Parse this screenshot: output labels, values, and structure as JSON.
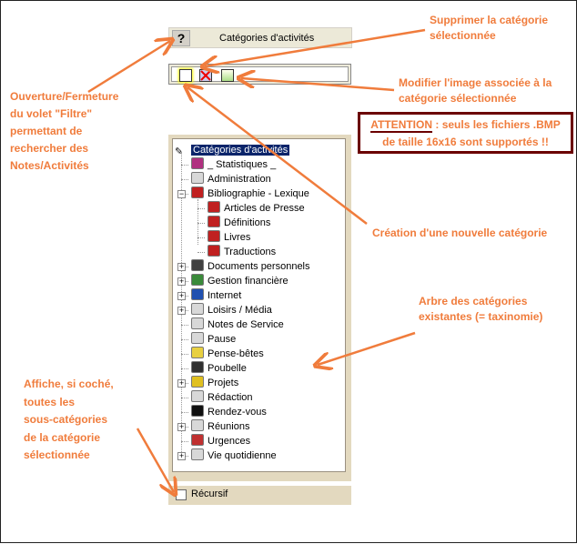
{
  "panel": {
    "help_label": "?",
    "title": "Catégories d'activités",
    "recursive_label": "Récursif",
    "recursive_checked": false
  },
  "toolbar": [
    {
      "icon": "new-category-icon"
    },
    {
      "icon": "delete-category-icon"
    },
    {
      "icon": "change-image-icon"
    }
  ],
  "tree": {
    "root": "Catégories d'activités",
    "items": [
      {
        "label": "_ Statistiques _",
        "level": 1,
        "expander": "",
        "icon": "#b03080"
      },
      {
        "label": "Administration",
        "level": 1,
        "expander": "",
        "icon": "#d8d8d8"
      },
      {
        "label": "Bibliographie - Lexique",
        "level": 1,
        "expander": "-",
        "icon": "#c02020"
      },
      {
        "label": "Articles de Presse",
        "level": 2,
        "expander": "",
        "icon": "#c02020"
      },
      {
        "label": "Définitions",
        "level": 2,
        "expander": "",
        "icon": "#c02020"
      },
      {
        "label": "Livres",
        "level": 2,
        "expander": "",
        "icon": "#c02020"
      },
      {
        "label": "Traductions",
        "level": 2,
        "expander": "",
        "icon": "#c02020"
      },
      {
        "label": "Documents personnels",
        "level": 1,
        "expander": "+",
        "icon": "#404040"
      },
      {
        "label": "Gestion financière",
        "level": 1,
        "expander": "+",
        "icon": "#3a8a3a"
      },
      {
        "label": "Internet",
        "level": 1,
        "expander": "+",
        "icon": "#2050b0"
      },
      {
        "label": "Loisirs / Média",
        "level": 1,
        "expander": "+",
        "icon": "#d8d8d8"
      },
      {
        "label": "Notes de Service",
        "level": 1,
        "expander": "",
        "icon": "#d8d8d8"
      },
      {
        "label": "Pause",
        "level": 1,
        "expander": "",
        "icon": "#d8d8d8"
      },
      {
        "label": "Pense-bêtes",
        "level": 1,
        "expander": "",
        "icon": "#e8d040"
      },
      {
        "label": "Poubelle",
        "level": 1,
        "expander": "",
        "icon": "#303030"
      },
      {
        "label": "Projets",
        "level": 1,
        "expander": "+",
        "icon": "#e0c020"
      },
      {
        "label": "Rédaction",
        "level": 1,
        "expander": "",
        "icon": "#d8d8d8"
      },
      {
        "label": "Rendez-vous",
        "level": 1,
        "expander": "",
        "icon": "#101010"
      },
      {
        "label": "Réunions",
        "level": 1,
        "expander": "+",
        "icon": "#d8d8d8"
      },
      {
        "label": "Urgences",
        "level": 1,
        "expander": "",
        "icon": "#c03030"
      },
      {
        "label": "Vie quotidienne",
        "level": 1,
        "expander": "+",
        "icon": "#d8d8d8"
      }
    ]
  },
  "annotations": {
    "delete": [
      "Supprimer la catégorie",
      "sélectionnée"
    ],
    "modify": [
      "Modifier l'image associée à la",
      "catégorie sélectionnée"
    ],
    "filter": [
      "Ouverture/Fermeture",
      "du volet \"Filtre\"",
      "permettant de",
      "rechercher des",
      "Notes/Activités"
    ],
    "create": [
      "Création d'une nouvelle catégorie"
    ],
    "tree": [
      "Arbre des catégories",
      "existantes (= taxinomie)"
    ],
    "recursive": [
      "Affiche, si coché,",
      "toutes les",
      "sous-catégories",
      "de la catégorie",
      "sélectionnée"
    ],
    "warning_strong": "ATTENTION",
    "warning_rest": " : seuls les fichiers .BMP",
    "warning_line2": "de taille 16x16 sont supportés !!"
  },
  "colors": {
    "annotation": "#f07c3c",
    "warning_border": "#6b0000",
    "selection": "#0a246a"
  }
}
